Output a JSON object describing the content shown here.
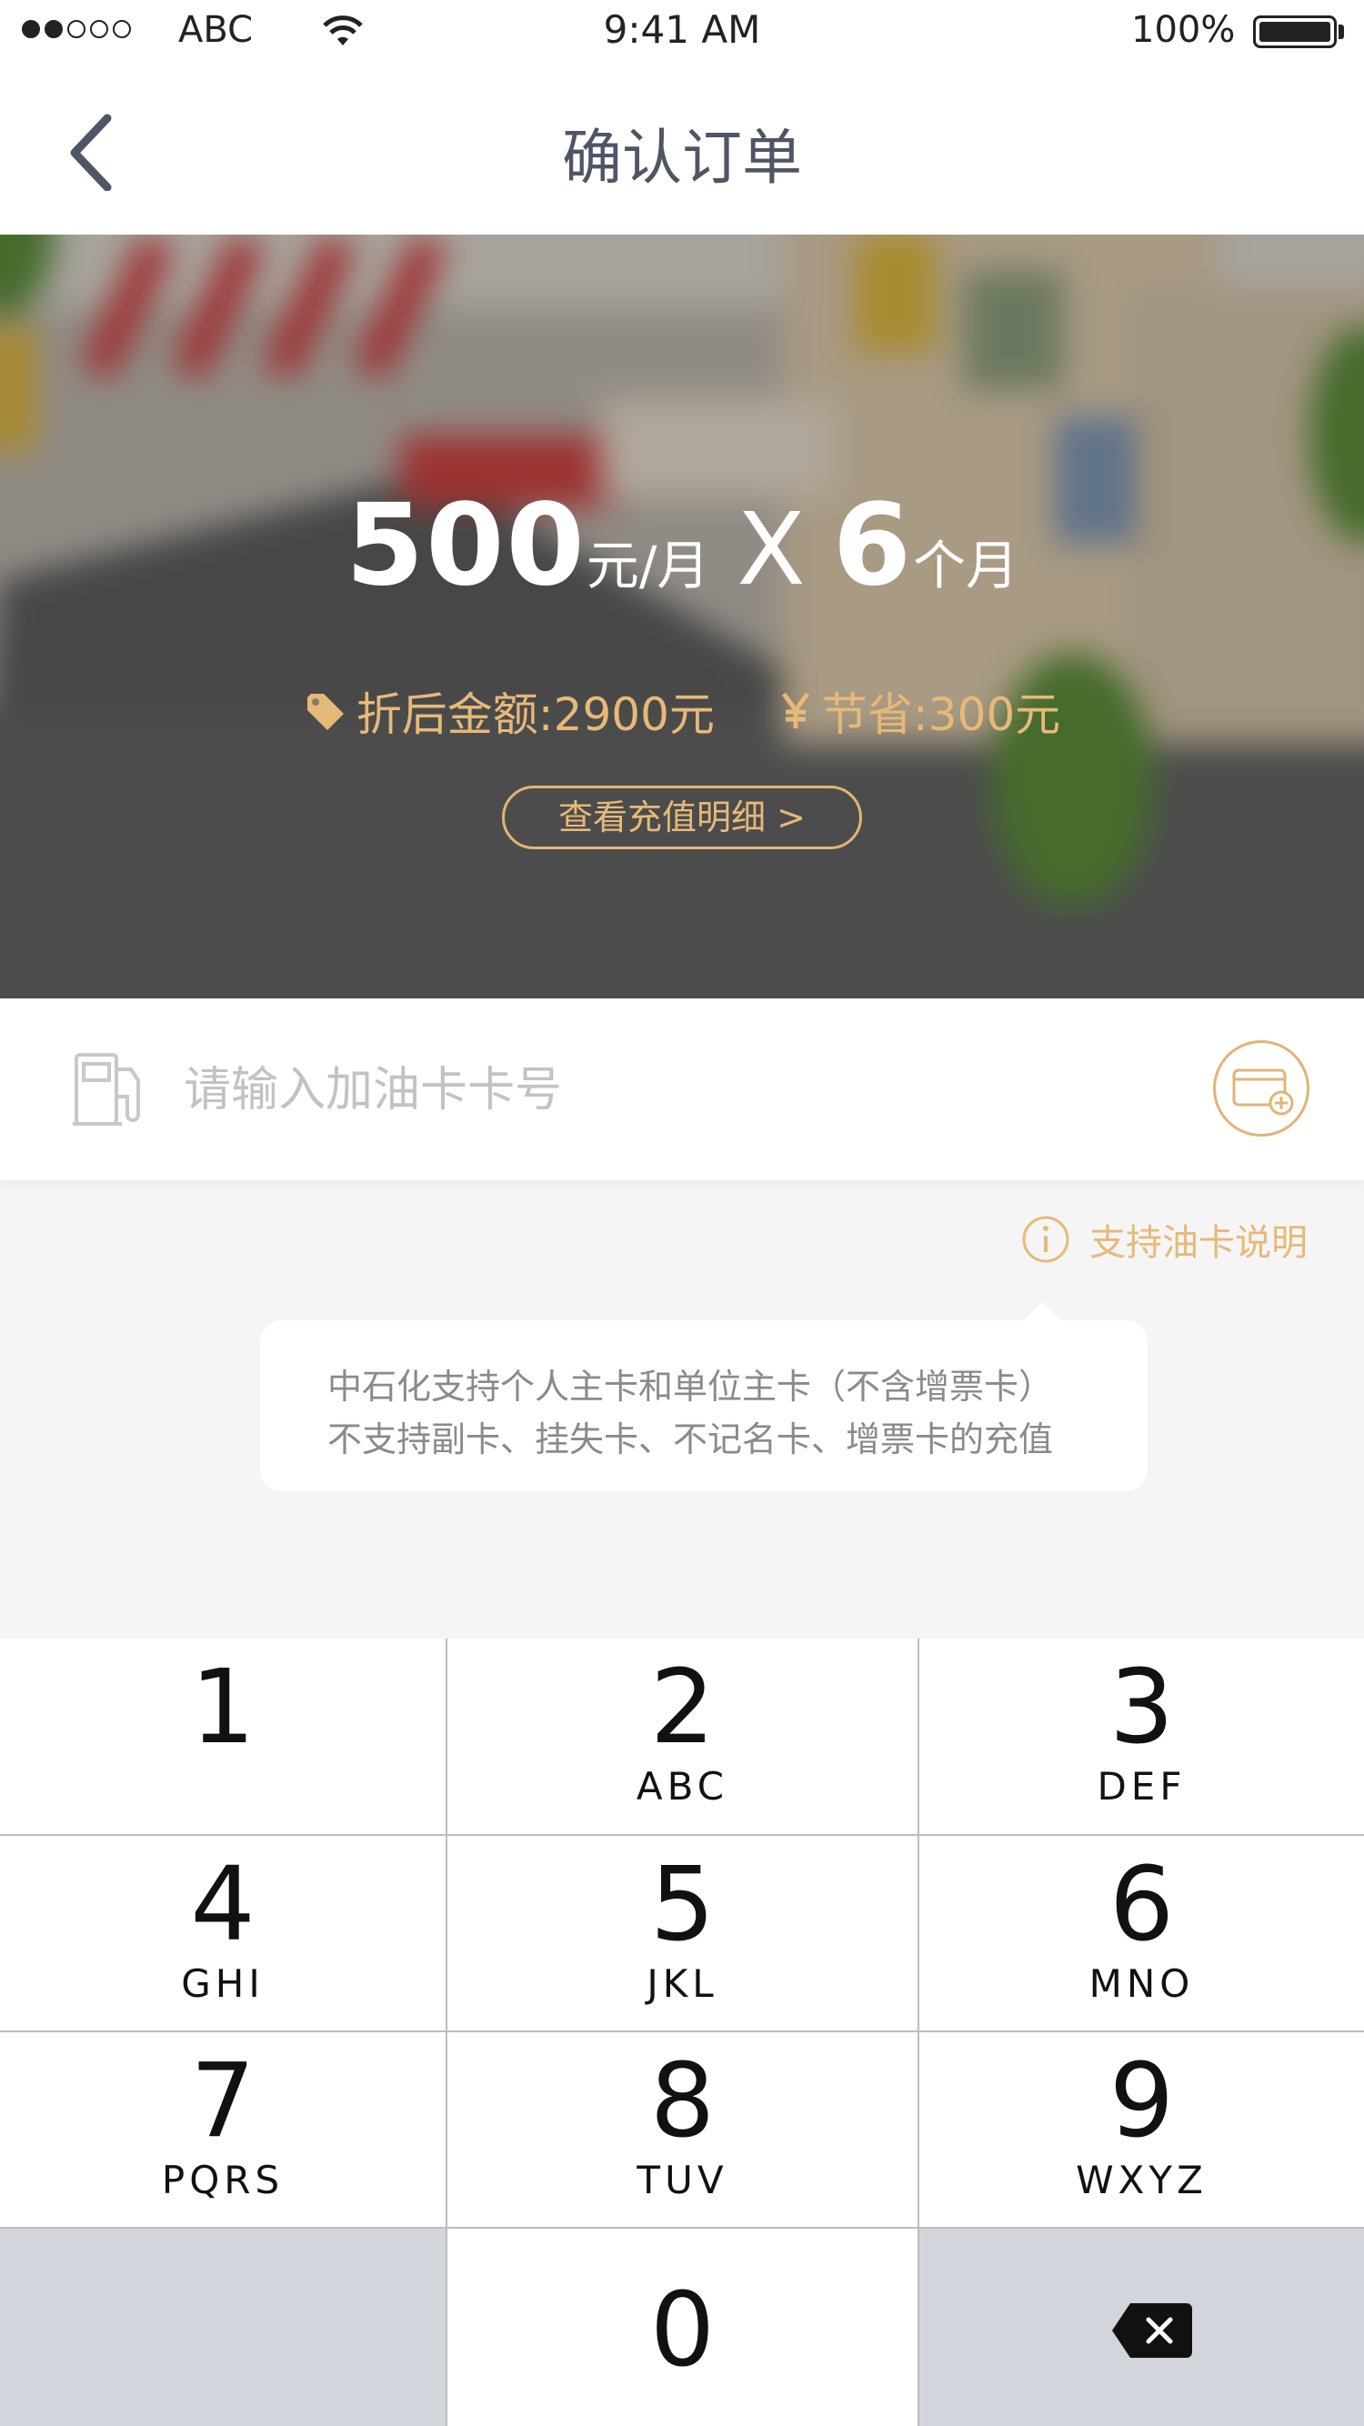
{
  "status_bar": {
    "carrier": "ABC",
    "time": "9:41 AM",
    "battery": "100%",
    "signal_strength": 2,
    "signal_total": 5
  },
  "nav": {
    "title": "确认订单",
    "back_icon": "chevron-left-icon"
  },
  "hero": {
    "amount": "500",
    "amount_unit": "元/月",
    "times_symbol": "X",
    "months": "6",
    "months_unit": "个月",
    "discount_label": "折后金额:2900元",
    "discount_icon": "price-tag-icon",
    "saving_label": "节省:300元",
    "saving_icon": "yuan-icon",
    "detail_button": "查看充值明细 >",
    "accent_color": "#e7b978"
  },
  "card_input": {
    "placeholder": "请输入加油卡卡号",
    "value": "",
    "left_icon": "gas-pump-icon",
    "right_icon": "add-card-icon"
  },
  "support": {
    "link_label": "支持油卡说明",
    "link_icon": "info-icon",
    "tooltip_lines": [
      "中石化支持个人主卡和单位主卡（不含增票卡）",
      "不支持副卡、挂失卡、不记名卡、增票卡的充值"
    ]
  },
  "keypad": {
    "keys": [
      {
        "num": "1",
        "letters": ""
      },
      {
        "num": "2",
        "letters": "ABC"
      },
      {
        "num": "3",
        "letters": "DEF"
      },
      {
        "num": "4",
        "letters": "GHI"
      },
      {
        "num": "5",
        "letters": "JKL"
      },
      {
        "num": "6",
        "letters": "MNO"
      },
      {
        "num": "7",
        "letters": "PQRS"
      },
      {
        "num": "8",
        "letters": "TUV"
      },
      {
        "num": "9",
        "letters": "WXYZ"
      },
      {
        "num": "0",
        "letters": ""
      }
    ],
    "delete_icon": "backspace-icon"
  }
}
